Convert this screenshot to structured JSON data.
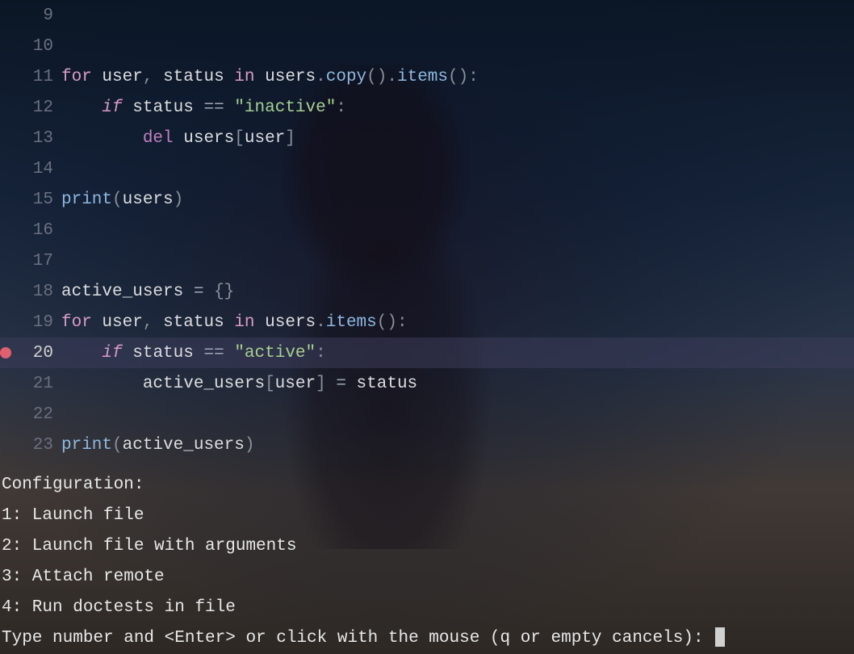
{
  "gutter": {
    "breakpoint_line": 20
  },
  "lines": [
    {
      "num": 9,
      "tokens": []
    },
    {
      "num": 10,
      "tokens": []
    },
    {
      "num": 11,
      "tokens": [
        {
          "c": "kw",
          "t": "for"
        },
        {
          "c": "v",
          "t": " "
        },
        {
          "c": "var",
          "t": "user"
        },
        {
          "c": "punc",
          "t": ","
        },
        {
          "c": "v",
          "t": " "
        },
        {
          "c": "var",
          "t": "status"
        },
        {
          "c": "v",
          "t": " "
        },
        {
          "c": "kw",
          "t": "in"
        },
        {
          "c": "v",
          "t": " "
        },
        {
          "c": "var",
          "t": "users"
        },
        {
          "c": "punc",
          "t": "."
        },
        {
          "c": "func",
          "t": "copy"
        },
        {
          "c": "paren",
          "t": "()"
        },
        {
          "c": "punc",
          "t": "."
        },
        {
          "c": "func",
          "t": "items"
        },
        {
          "c": "paren",
          "t": "()"
        },
        {
          "c": "punc",
          "t": ":"
        }
      ]
    },
    {
      "num": 12,
      "tokens": [
        {
          "c": "v",
          "t": "    "
        },
        {
          "c": "kw-italic",
          "t": "if"
        },
        {
          "c": "v",
          "t": " "
        },
        {
          "c": "var",
          "t": "status"
        },
        {
          "c": "v",
          "t": " "
        },
        {
          "c": "op",
          "t": "=="
        },
        {
          "c": "v",
          "t": " "
        },
        {
          "c": "str",
          "t": "\"inactive\""
        },
        {
          "c": "punc",
          "t": ":"
        }
      ]
    },
    {
      "num": 13,
      "tokens": [
        {
          "c": "v",
          "t": "        "
        },
        {
          "c": "del",
          "t": "del"
        },
        {
          "c": "v",
          "t": " "
        },
        {
          "c": "var",
          "t": "users"
        },
        {
          "c": "bracket",
          "t": "["
        },
        {
          "c": "var",
          "t": "user"
        },
        {
          "c": "bracket",
          "t": "]"
        }
      ]
    },
    {
      "num": 14,
      "tokens": []
    },
    {
      "num": 15,
      "tokens": [
        {
          "c": "func",
          "t": "print"
        },
        {
          "c": "paren",
          "t": "("
        },
        {
          "c": "var",
          "t": "users"
        },
        {
          "c": "paren",
          "t": ")"
        }
      ]
    },
    {
      "num": 16,
      "tokens": []
    },
    {
      "num": 17,
      "tokens": []
    },
    {
      "num": 18,
      "tokens": [
        {
          "c": "var",
          "t": "active_users"
        },
        {
          "c": "v",
          "t": " "
        },
        {
          "c": "op",
          "t": "="
        },
        {
          "c": "v",
          "t": " "
        },
        {
          "c": "bracket",
          "t": "{}"
        }
      ]
    },
    {
      "num": 19,
      "tokens": [
        {
          "c": "kw",
          "t": "for"
        },
        {
          "c": "v",
          "t": " "
        },
        {
          "c": "var",
          "t": "user"
        },
        {
          "c": "punc",
          "t": ","
        },
        {
          "c": "v",
          "t": " "
        },
        {
          "c": "var",
          "t": "status"
        },
        {
          "c": "v",
          "t": " "
        },
        {
          "c": "kw",
          "t": "in"
        },
        {
          "c": "v",
          "t": " "
        },
        {
          "c": "var",
          "t": "users"
        },
        {
          "c": "punc",
          "t": "."
        },
        {
          "c": "func",
          "t": "items"
        },
        {
          "c": "paren",
          "t": "()"
        },
        {
          "c": "punc",
          "t": ":"
        }
      ]
    },
    {
      "num": 20,
      "highlighted": true,
      "tokens": [
        {
          "c": "v",
          "t": "    "
        },
        {
          "c": "kw-italic",
          "t": "if"
        },
        {
          "c": "v",
          "t": " "
        },
        {
          "c": "var",
          "t": "status"
        },
        {
          "c": "v",
          "t": " "
        },
        {
          "c": "op",
          "t": "=="
        },
        {
          "c": "v",
          "t": " "
        },
        {
          "c": "str",
          "t": "\"active\""
        },
        {
          "c": "punc",
          "t": ":"
        }
      ]
    },
    {
      "num": 21,
      "tokens": [
        {
          "c": "v",
          "t": "        "
        },
        {
          "c": "var",
          "t": "active_users"
        },
        {
          "c": "bracket",
          "t": "["
        },
        {
          "c": "var",
          "t": "user"
        },
        {
          "c": "bracket",
          "t": "]"
        },
        {
          "c": "v",
          "t": " "
        },
        {
          "c": "op",
          "t": "="
        },
        {
          "c": "v",
          "t": " "
        },
        {
          "c": "var",
          "t": "status"
        }
      ]
    },
    {
      "num": 22,
      "tokens": []
    },
    {
      "num": 23,
      "tokens": [
        {
          "c": "func",
          "t": "print"
        },
        {
          "c": "paren",
          "t": "("
        },
        {
          "c": "var",
          "t": "active_users"
        },
        {
          "c": "paren",
          "t": ")"
        }
      ]
    }
  ],
  "prompt": {
    "header": "Configuration:",
    "options": [
      {
        "key": "1",
        "label": "Launch file"
      },
      {
        "key": "2",
        "label": "Launch file with arguments"
      },
      {
        "key": "3",
        "label": "Attach remote"
      },
      {
        "key": "4",
        "label": "Run doctests in file"
      }
    ],
    "input_line": "Type number and <Enter> or click with the mouse (q or empty cancels): "
  }
}
